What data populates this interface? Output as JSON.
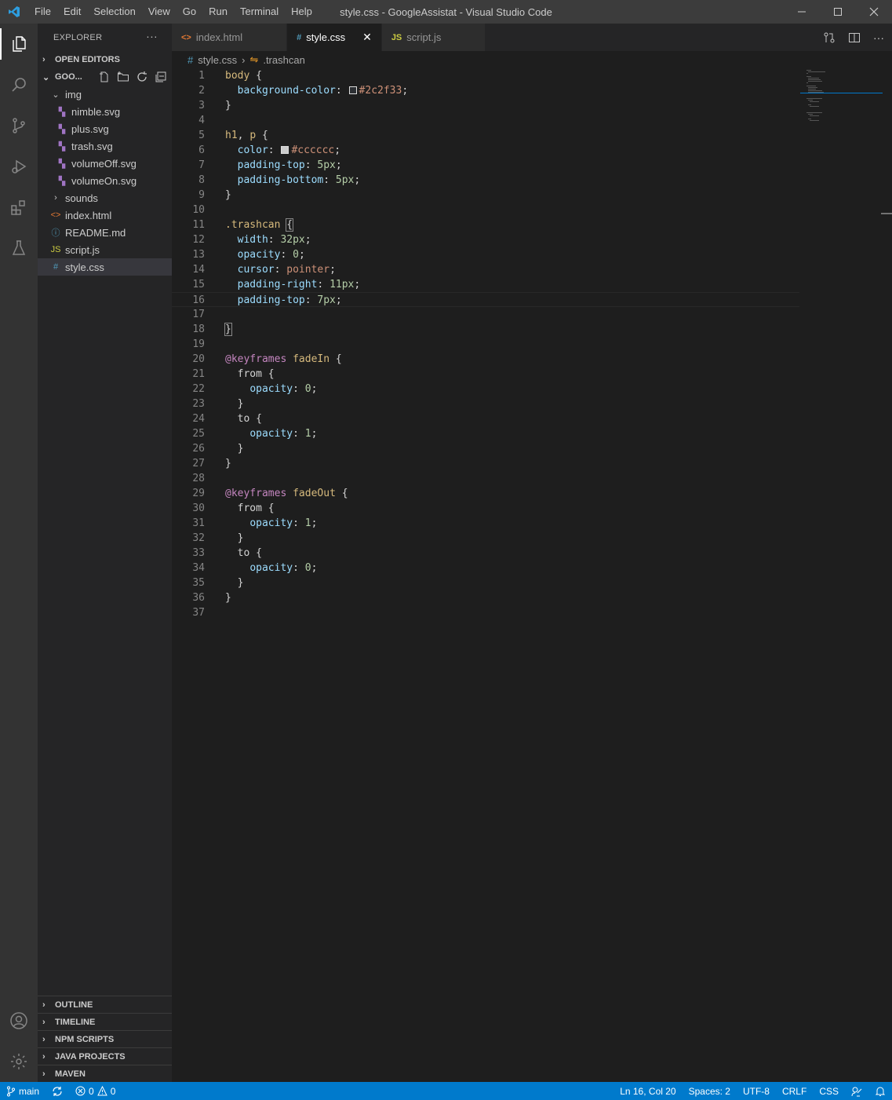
{
  "window": {
    "title": "style.css - GoogleAssistat - Visual Studio Code",
    "menu": [
      "File",
      "Edit",
      "Selection",
      "View",
      "Go",
      "Run",
      "Terminal",
      "Help"
    ]
  },
  "sidebar": {
    "header": "EXPLORER",
    "open_editors": "OPEN EDITORS",
    "folder": "GOO...",
    "tree": [
      {
        "label": "img",
        "kind": "folder-open",
        "indent": 1
      },
      {
        "label": "nimble.svg",
        "kind": "svg",
        "indent": 2
      },
      {
        "label": "plus.svg",
        "kind": "svg",
        "indent": 2
      },
      {
        "label": "trash.svg",
        "kind": "svg",
        "indent": 2
      },
      {
        "label": "volumeOff.svg",
        "kind": "svg",
        "indent": 2
      },
      {
        "label": "volumeOn.svg",
        "kind": "svg",
        "indent": 2
      },
      {
        "label": "sounds",
        "kind": "folder",
        "indent": 1
      },
      {
        "label": "index.html",
        "kind": "html",
        "indent": 1
      },
      {
        "label": "README.md",
        "kind": "md",
        "indent": 1
      },
      {
        "label": "script.js",
        "kind": "js",
        "indent": 1
      },
      {
        "label": "style.css",
        "kind": "css",
        "indent": 1,
        "selected": true
      }
    ],
    "bottom_sections": [
      "OUTLINE",
      "TIMELINE",
      "NPM SCRIPTS",
      "JAVA PROJECTS",
      "MAVEN"
    ]
  },
  "tabs": [
    {
      "label": "index.html",
      "icon": "<>",
      "icon_color": "#e37933",
      "active": false
    },
    {
      "label": "style.css",
      "icon": "#",
      "icon_color": "#519aba",
      "active": true
    },
    {
      "label": "script.js",
      "icon": "JS",
      "icon_color": "#cbcb41",
      "active": false
    }
  ],
  "breadcrumb": {
    "file": "style.css",
    "symbol": ".trashcan"
  },
  "editor": {
    "current_line": 16,
    "lines": [
      [
        [
          "sel",
          "body"
        ],
        [
          "punc",
          " {"
        ]
      ],
      [
        [
          "punc",
          "  "
        ],
        [
          "prop",
          "background-color"
        ],
        [
          "punc",
          ": "
        ],
        [
          "swatch",
          "#2c2f33"
        ],
        [
          "val",
          "#2c2f33"
        ],
        [
          "punc",
          ";"
        ]
      ],
      [
        [
          "punc",
          "}"
        ]
      ],
      [],
      [
        [
          "sel",
          "h1"
        ],
        [
          "punc",
          ", "
        ],
        [
          "sel",
          "p"
        ],
        [
          "punc",
          " {"
        ]
      ],
      [
        [
          "punc",
          "  "
        ],
        [
          "prop",
          "color"
        ],
        [
          "punc",
          ": "
        ],
        [
          "swatch",
          "#cccccc"
        ],
        [
          "val",
          "#cccccc"
        ],
        [
          "punc",
          ";"
        ]
      ],
      [
        [
          "punc",
          "  "
        ],
        [
          "prop",
          "padding-top"
        ],
        [
          "punc",
          ": "
        ],
        [
          "num",
          "5px"
        ],
        [
          "punc",
          ";"
        ]
      ],
      [
        [
          "punc",
          "  "
        ],
        [
          "prop",
          "padding-bottom"
        ],
        [
          "punc",
          ": "
        ],
        [
          "num",
          "5px"
        ],
        [
          "punc",
          ";"
        ]
      ],
      [
        [
          "punc",
          "}"
        ]
      ],
      [],
      [
        [
          "sel",
          ".trashcan"
        ],
        [
          "punc",
          " "
        ],
        [
          "bracket",
          "{"
        ]
      ],
      [
        [
          "punc",
          "  "
        ],
        [
          "prop",
          "width"
        ],
        [
          "punc",
          ": "
        ],
        [
          "num",
          "32px"
        ],
        [
          "punc",
          ";"
        ]
      ],
      [
        [
          "punc",
          "  "
        ],
        [
          "prop",
          "opacity"
        ],
        [
          "punc",
          ": "
        ],
        [
          "num",
          "0"
        ],
        [
          "punc",
          ";"
        ]
      ],
      [
        [
          "punc",
          "  "
        ],
        [
          "prop",
          "cursor"
        ],
        [
          "punc",
          ": "
        ],
        [
          "val",
          "pointer"
        ],
        [
          "punc",
          ";"
        ]
      ],
      [
        [
          "punc",
          "  "
        ],
        [
          "prop",
          "padding-right"
        ],
        [
          "punc",
          ": "
        ],
        [
          "num",
          "11px"
        ],
        [
          "punc",
          ";"
        ]
      ],
      [
        [
          "punc",
          "  "
        ],
        [
          "prop",
          "padding-top"
        ],
        [
          "punc",
          ": "
        ],
        [
          "num",
          "7px"
        ],
        [
          "punc",
          ";"
        ]
      ],
      [],
      [
        [
          "bracket",
          "}"
        ]
      ],
      [],
      [
        [
          "at",
          "@keyframes"
        ],
        [
          "punc",
          " "
        ],
        [
          "sel",
          "fadeIn"
        ],
        [
          "punc",
          " {"
        ]
      ],
      [
        [
          "punc",
          "  from {"
        ]
      ],
      [
        [
          "punc",
          "    "
        ],
        [
          "prop",
          "opacity"
        ],
        [
          "punc",
          ": "
        ],
        [
          "num",
          "0"
        ],
        [
          "punc",
          ";"
        ]
      ],
      [
        [
          "punc",
          "  }"
        ]
      ],
      [
        [
          "punc",
          "  to {"
        ]
      ],
      [
        [
          "punc",
          "    "
        ],
        [
          "prop",
          "opacity"
        ],
        [
          "punc",
          ": "
        ],
        [
          "num",
          "1"
        ],
        [
          "punc",
          ";"
        ]
      ],
      [
        [
          "punc",
          "  }"
        ]
      ],
      [
        [
          "punc",
          "}"
        ]
      ],
      [],
      [
        [
          "at",
          "@keyframes"
        ],
        [
          "punc",
          " "
        ],
        [
          "sel",
          "fadeOut"
        ],
        [
          "punc",
          " {"
        ]
      ],
      [
        [
          "punc",
          "  from {"
        ]
      ],
      [
        [
          "punc",
          "    "
        ],
        [
          "prop",
          "opacity"
        ],
        [
          "punc",
          ": "
        ],
        [
          "num",
          "1"
        ],
        [
          "punc",
          ";"
        ]
      ],
      [
        [
          "punc",
          "  }"
        ]
      ],
      [
        [
          "punc",
          "  to {"
        ]
      ],
      [
        [
          "punc",
          "    "
        ],
        [
          "prop",
          "opacity"
        ],
        [
          "punc",
          ": "
        ],
        [
          "num",
          "0"
        ],
        [
          "punc",
          ";"
        ]
      ],
      [
        [
          "punc",
          "  }"
        ]
      ],
      [
        [
          "punc",
          "}"
        ]
      ],
      []
    ]
  },
  "status": {
    "branch": "main",
    "errors": "0",
    "warnings": "0",
    "position": "Ln 16, Col 20",
    "spaces": "Spaces: 2",
    "encoding": "UTF-8",
    "eol": "CRLF",
    "language": "CSS"
  },
  "colors": {
    "accent": "#007acc",
    "activity_bar": "#333333",
    "sidebar": "#252526",
    "editor": "#1e1e1e"
  }
}
